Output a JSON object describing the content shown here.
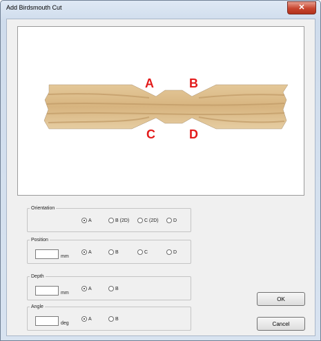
{
  "window": {
    "title": "Add Birdsmouth Cut",
    "close_label": "✕"
  },
  "preview": {
    "labels": [
      "A",
      "B",
      "C",
      "D"
    ]
  },
  "orientation": {
    "legend": "Orientation",
    "options": [
      "A",
      "B (2D)",
      "C (2D)",
      "D"
    ],
    "selected": "A"
  },
  "position": {
    "legend": "Position",
    "value": "",
    "unit": "mm",
    "options": [
      "A",
      "B",
      "C",
      "D"
    ],
    "selected": "A"
  },
  "depth": {
    "legend": "Depth",
    "value": "",
    "unit": "mm",
    "options": [
      "A",
      "B"
    ],
    "selected": "A"
  },
  "angle": {
    "legend": "Angle",
    "value": "",
    "unit": "deg",
    "options": [
      "A",
      "B"
    ],
    "selected": "A"
  },
  "buttons": {
    "ok": "OK",
    "cancel": "Cancel"
  }
}
